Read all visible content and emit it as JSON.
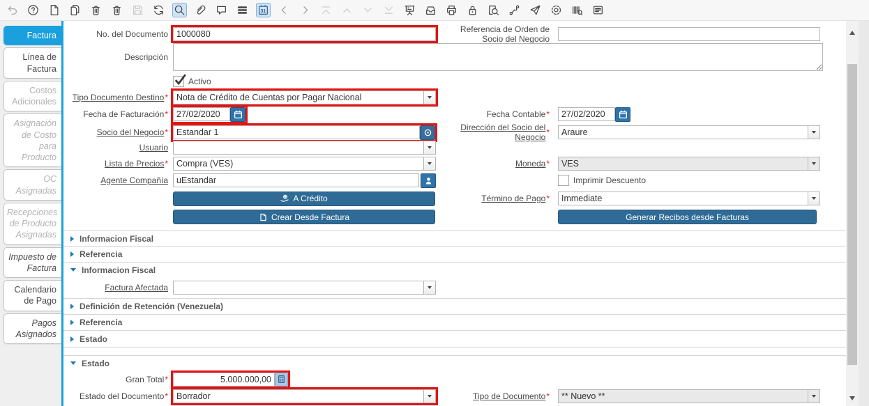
{
  "ui": {
    "required_marker": "*"
  },
  "toolbar": {
    "calendar_day": "31",
    "icons": [
      "undo-icon",
      "help-icon",
      "new-record-icon",
      "copy-record-icon",
      "delete-record-icon",
      "delete-selection-icon",
      "save-icon",
      "refresh-icon",
      "find-icon",
      "attachment-icon",
      "chat-icon",
      "grid-toggle-icon",
      "calendar-icon",
      "previous-record-icon",
      "next-record-icon",
      "first-record-icon",
      "parent-record-icon",
      "detail-record-icon",
      "last-record-icon",
      "presentation-icon",
      "archive-icon",
      "print-icon",
      "lock-icon",
      "report-icon",
      "workflow-icon",
      "send-icon",
      "settings-icon",
      "barcode-icon",
      "help-panel-icon"
    ]
  },
  "sidebar": {
    "tabs": [
      {
        "label": "Factura"
      },
      {
        "label": "Línea de Factura"
      },
      {
        "label": "Costos Adicionales"
      },
      {
        "label": "Asignación de Costo para Producto"
      },
      {
        "label": "OC Asignadas"
      },
      {
        "label": "Recepciones de Producto Asignadas"
      },
      {
        "label": "Impuesto de Factura"
      },
      {
        "label": "Calendario de Pago"
      },
      {
        "label": "Pagos Asignados"
      }
    ]
  },
  "form": {
    "document_no": {
      "label": "No. del Documento",
      "value": "1000080"
    },
    "bp_order_ref": {
      "label": "Referencia de Orden de Socio del Negocio",
      "value": ""
    },
    "description": {
      "label": "Descripción",
      "value": ""
    },
    "active": {
      "label": "Activo",
      "checked": true
    },
    "target_doc_type": {
      "label": "Tipo Documento Destino",
      "required": true,
      "value": "Nota de Crédito de Cuentas por Pagar Nacional"
    },
    "invoice_date": {
      "label": "Fecha de Facturación",
      "required": true,
      "value": "27/02/2020"
    },
    "account_date": {
      "label": "Fecha Contable",
      "required": true,
      "value": "27/02/2020"
    },
    "business_partner": {
      "label": "Socio del Negocio",
      "required": true,
      "value": "Estandar 1"
    },
    "bp_address": {
      "label": "Dirección del Socio del Negocio",
      "required": true,
      "value": "Araure"
    },
    "user": {
      "label": "Usuario",
      "value": ""
    },
    "price_list": {
      "label": "Lista de Precios",
      "required": true,
      "value": "Compra (VES)"
    },
    "currency": {
      "label": "Moneda",
      "required": true,
      "value": "VES",
      "disabled": true
    },
    "company_agent": {
      "label": "Agente Compañía",
      "value": "uEstandar"
    },
    "print_discount": {
      "label": "Imprimir Descuento",
      "checked": false
    },
    "payment_term": {
      "label": "Término de Pago",
      "required": true,
      "value": "Immediate"
    },
    "affected_invoice": {
      "label": "Factura Afectada",
      "value": ""
    },
    "grand_total": {
      "label": "Gran Total",
      "required": true,
      "value": "5.000.000,00"
    },
    "doc_status": {
      "label": "Estado del Documento",
      "required": true,
      "value": "Borrador"
    },
    "doc_type": {
      "label": "Tipo de Documento",
      "required": true,
      "value": "** Nuevo **",
      "disabled": true
    }
  },
  "buttons": {
    "on_credit": "A Crédito",
    "create_from_invoice": "Crear Desde Factura",
    "generate_receipts": "Generar Recibos desde Facturas"
  },
  "sections": [
    {
      "label": "Informacion Fiscal",
      "expanded": false
    },
    {
      "label": "Referencia",
      "expanded": false
    },
    {
      "label": "Informacion Fiscal",
      "expanded": true
    },
    {
      "label": "Definición de Retención (Venezuela)",
      "expanded": false
    },
    {
      "label": "Referencia",
      "expanded": false
    },
    {
      "label": "Estado",
      "expanded": false
    },
    {
      "label": "Estado",
      "expanded": true
    }
  ],
  "colors": {
    "accent_blue": "#1aa1dd",
    "button_blue": "#2f6b96",
    "highlight_red": "#e41414",
    "toolbar_highlight": "#cfe3f6"
  }
}
